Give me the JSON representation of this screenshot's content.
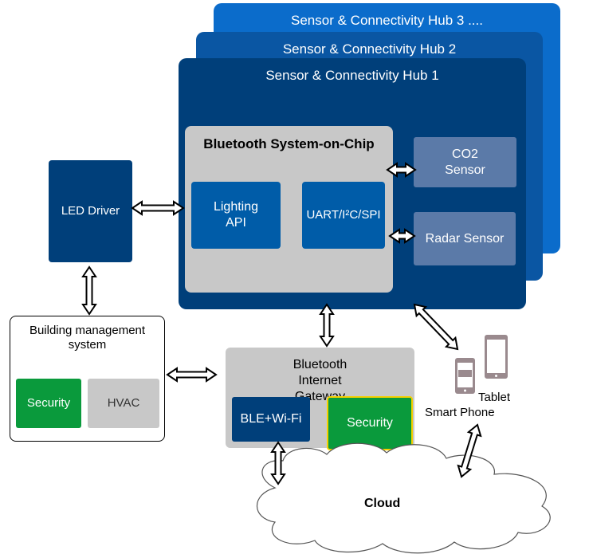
{
  "hubs": [
    {
      "title": "Sensor & Connectivity Hub 3 ....",
      "color": "#0b6ccb"
    },
    {
      "title": "Sensor & Connectivity Hub 2",
      "color": "#0a56a3"
    },
    {
      "title": "Sensor & Connectivity Hub 1",
      "color": "#003f7a"
    }
  ],
  "soc": {
    "title": "Bluetooth System-on-Chip",
    "lighting_api": "Lighting API",
    "uart": "UART/I²C/SPI"
  },
  "sensors": {
    "co2": "CO2 Sensor",
    "radar": "Radar Sensor"
  },
  "led_driver": "LED Driver",
  "bms": {
    "title": "Building management system",
    "security": "Security",
    "hvac": "HVAC"
  },
  "gateway": {
    "title": "Bluetooth Internet Gateway",
    "ble_wifi": "BLE+Wi-Fi",
    "security": "Security"
  },
  "cloud": "Cloud",
  "devices": {
    "tablet": "Tablet",
    "smart_phone": "Smart Phone"
  },
  "colors": {
    "dark_blue": "#003f7a",
    "mid_blue": "#005ca8",
    "sensor_blue": "#5b7aa8",
    "gray": "#c8c8c8",
    "green": "#0a9a3c",
    "yellow": "#f5d000",
    "device_gray": "#9a8a8e"
  }
}
